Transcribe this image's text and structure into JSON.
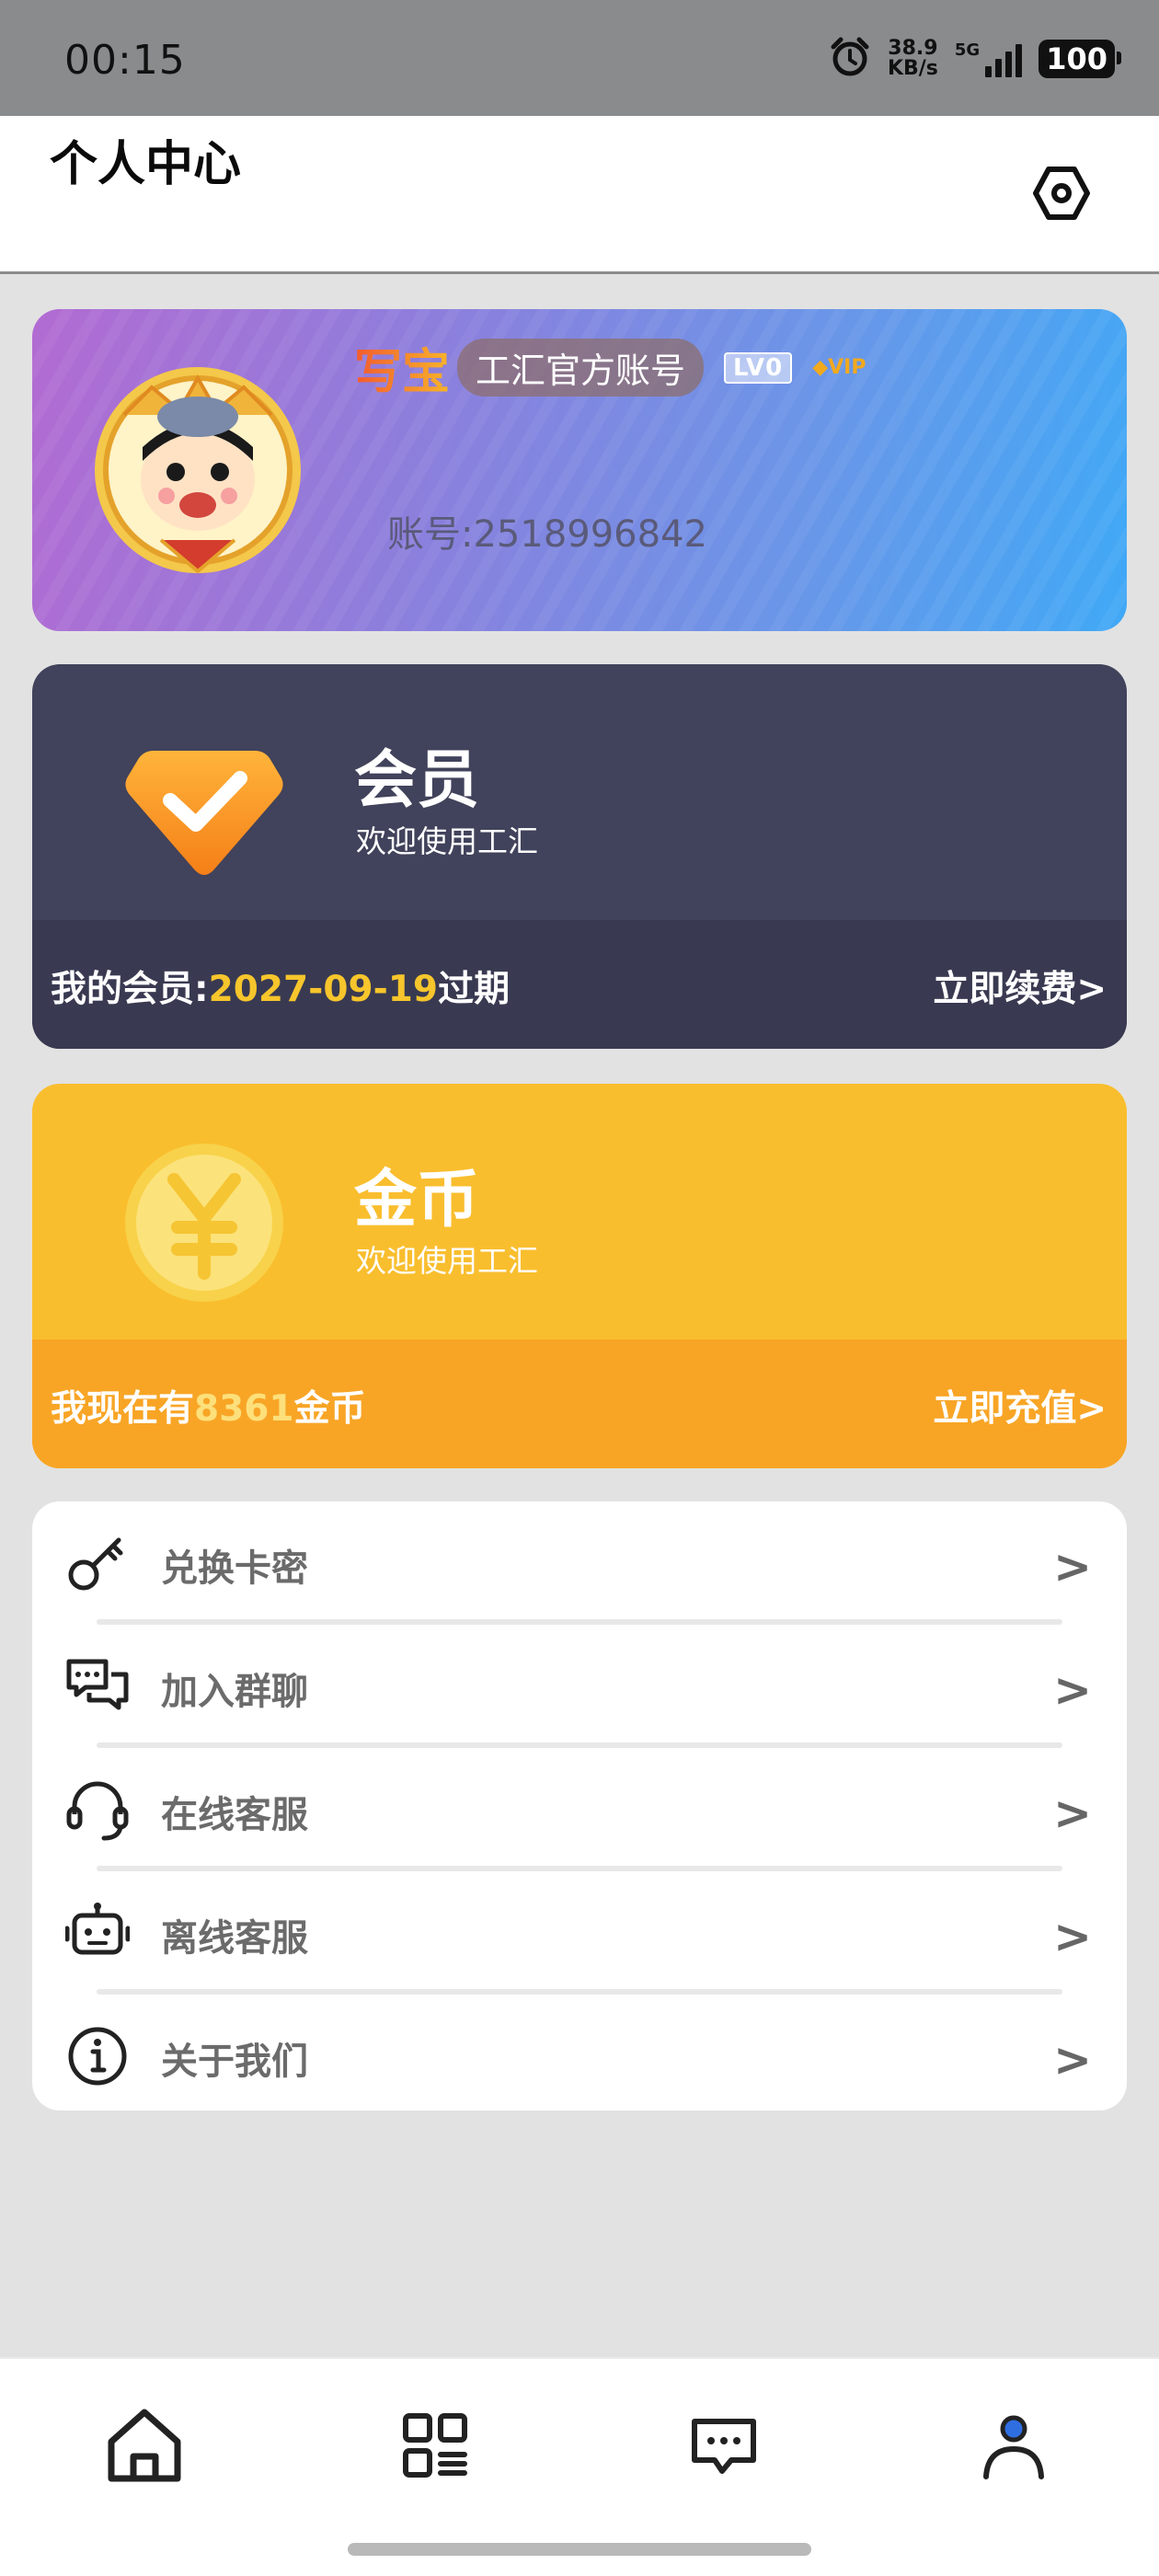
{
  "status_bar": {
    "time": "00:15",
    "net_speed_value": "38.9",
    "net_speed_unit": "KB/s",
    "network_type": "5G",
    "battery": "100"
  },
  "header": {
    "title": "个人中心",
    "settings_icon": "gear-icon"
  },
  "profile": {
    "nickname": "写宝",
    "official_badge": "工汇官方账号",
    "level_badge": "LV0",
    "vip_badge": "VIP",
    "account_line": "账号:2518996842",
    "gradient_start": "#b26bd2",
    "gradient_end": "#40a9f6"
  },
  "member_card": {
    "title": "会员",
    "subtitle": "欢迎使用工汇",
    "footer_prefix": "我的会员:",
    "expire_date": "2027-09-19",
    "footer_suffix": "过期",
    "action": "立即续费>",
    "color": "#41425b",
    "highlight": "#f7c52c"
  },
  "coin_card": {
    "title": "金币",
    "subtitle": "欢迎使用工汇",
    "footer_prefix": "我现在有",
    "coin_count": "8361",
    "footer_suffix": "金币",
    "action": "立即充值>",
    "color": "#f9be2e"
  },
  "menu": {
    "items": [
      {
        "label": "兑换卡密",
        "icon": "key-icon",
        "arrow": ">"
      },
      {
        "label": "加入群聊",
        "icon": "chat-bubbles-icon",
        "arrow": ">"
      },
      {
        "label": "在线客服",
        "icon": "headset-icon",
        "arrow": ">"
      },
      {
        "label": "离线客服",
        "icon": "robot-icon",
        "arrow": ">"
      },
      {
        "label": "关于我们",
        "icon": "info-icon",
        "arrow": ">"
      }
    ]
  },
  "bottom_nav": {
    "items": [
      {
        "icon": "home-icon"
      },
      {
        "icon": "grid-apps-icon"
      },
      {
        "icon": "message-icon"
      },
      {
        "icon": "profile-icon",
        "active": true
      }
    ],
    "active_color": "#2f6ee0"
  }
}
